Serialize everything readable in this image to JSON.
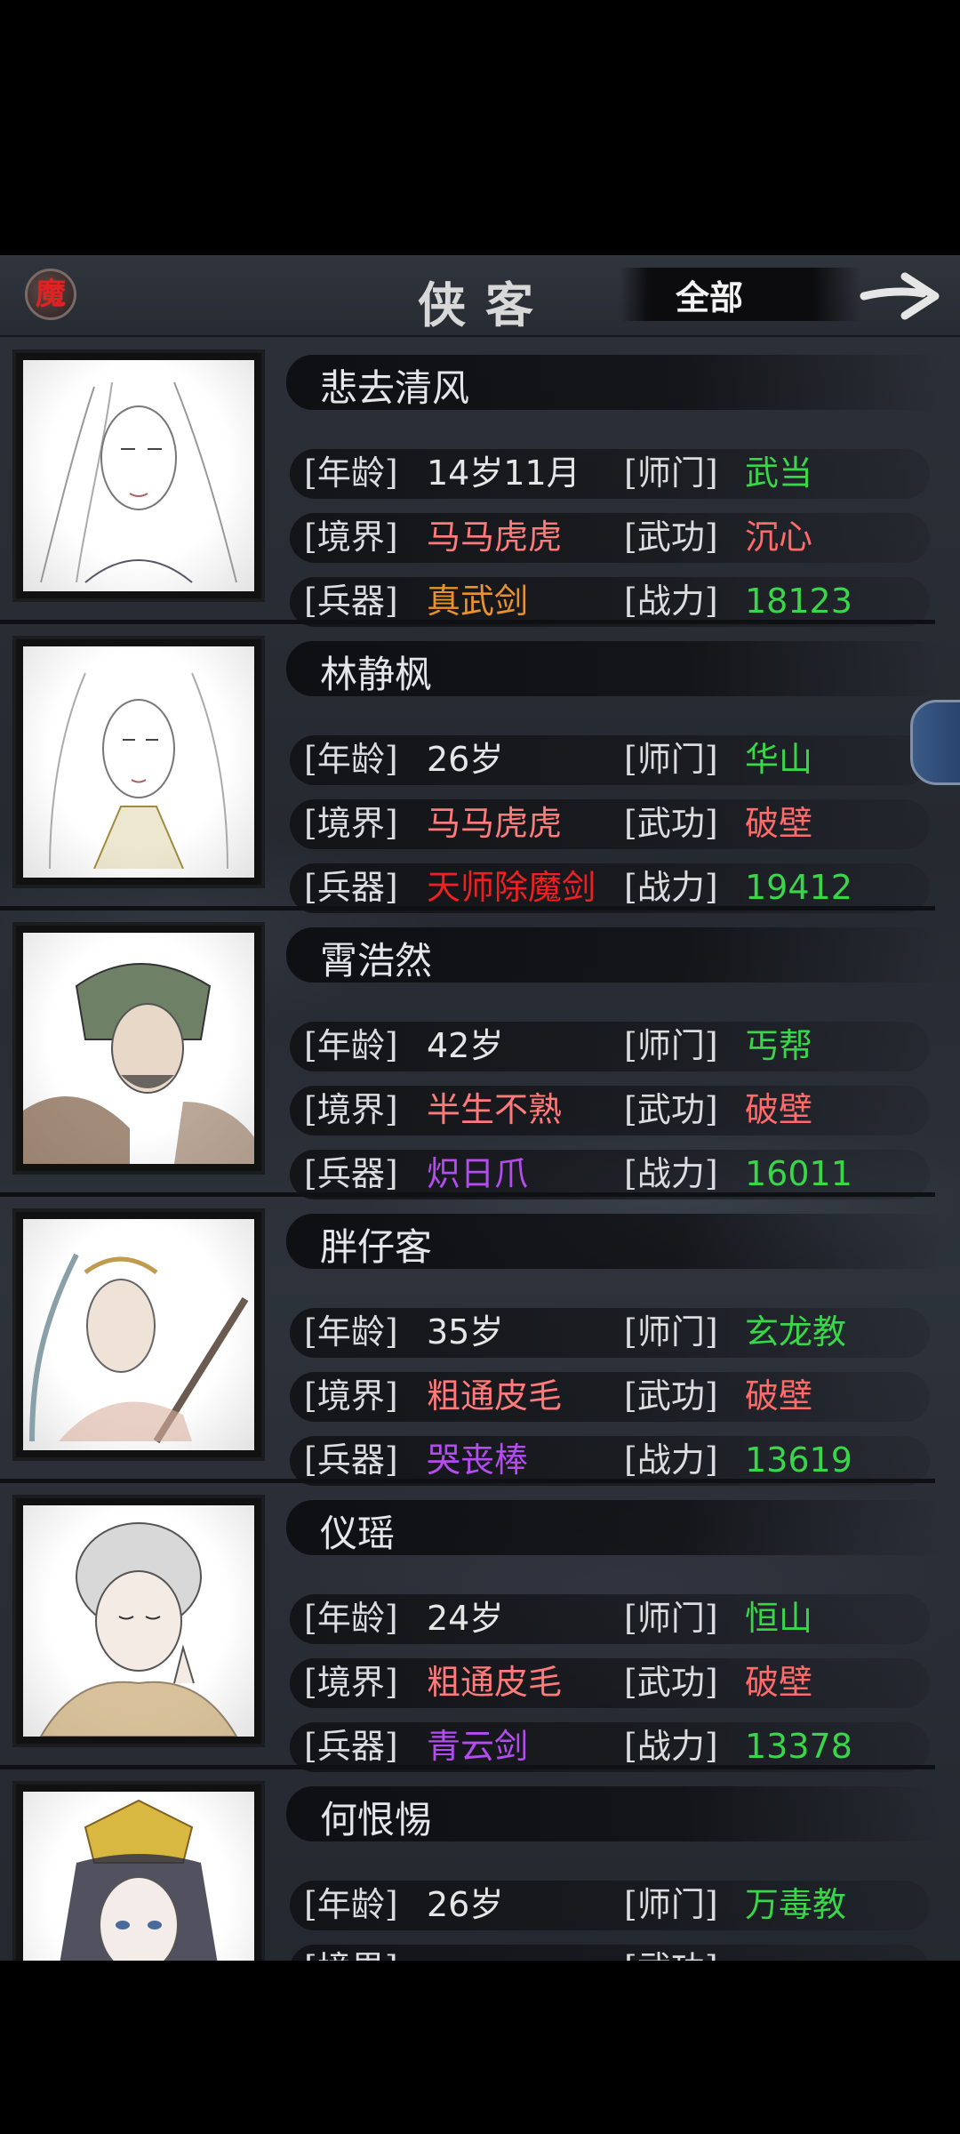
{
  "header": {
    "badge_char": "魔",
    "title": "侠客",
    "filter_label": "全部",
    "next_icon": "arrow-right-icon"
  },
  "labels": {
    "age": "[年龄]",
    "sect": "[师门]",
    "realm": "[境界]",
    "skill": "[武功]",
    "weapon": "[兵器]",
    "power": "[战力]"
  },
  "colors": {
    "sect": "#39d64a",
    "power": "#39d64a",
    "realm": "#ff7a7a",
    "skill": "#ff6a6a",
    "age": "#e6e6e6"
  },
  "heroes": [
    {
      "name": "悲去清风",
      "age": "14岁11月",
      "sect": "武当",
      "realm": "马马虎虎",
      "skill": "沉心",
      "weapon": "真武剑",
      "weapon_color": "#e8922e",
      "power": "18123"
    },
    {
      "name": "林静枫",
      "age": "26岁",
      "sect": "华山",
      "realm": "马马虎虎",
      "skill": "破壁",
      "weapon": "天师除魔剑",
      "weapon_color": "#ee2020",
      "power": "19412"
    },
    {
      "name": "霄浩然",
      "age": "42岁",
      "sect": "丐帮",
      "realm": "半生不熟",
      "skill": "破壁",
      "weapon": "炽日爪",
      "weapon_color": "#b44cf0",
      "power": "16011"
    },
    {
      "name": "胖仔客",
      "age": "35岁",
      "sect": "玄龙教",
      "realm": "粗通皮毛",
      "skill": "破壁",
      "weapon": "哭丧棒",
      "weapon_color": "#b44cf0",
      "power": "13619"
    },
    {
      "name": "仪瑶",
      "age": "24岁",
      "sect": "恒山",
      "realm": "粗通皮毛",
      "skill": "破壁",
      "weapon": "青云剑",
      "weapon_color": "#b44cf0",
      "power": "13378"
    },
    {
      "name": "何恨惕",
      "age": "26岁",
      "sect": "万毒教",
      "realm": "",
      "skill": "",
      "weapon": "",
      "weapon_color": "#b44cf0",
      "power": ""
    }
  ]
}
